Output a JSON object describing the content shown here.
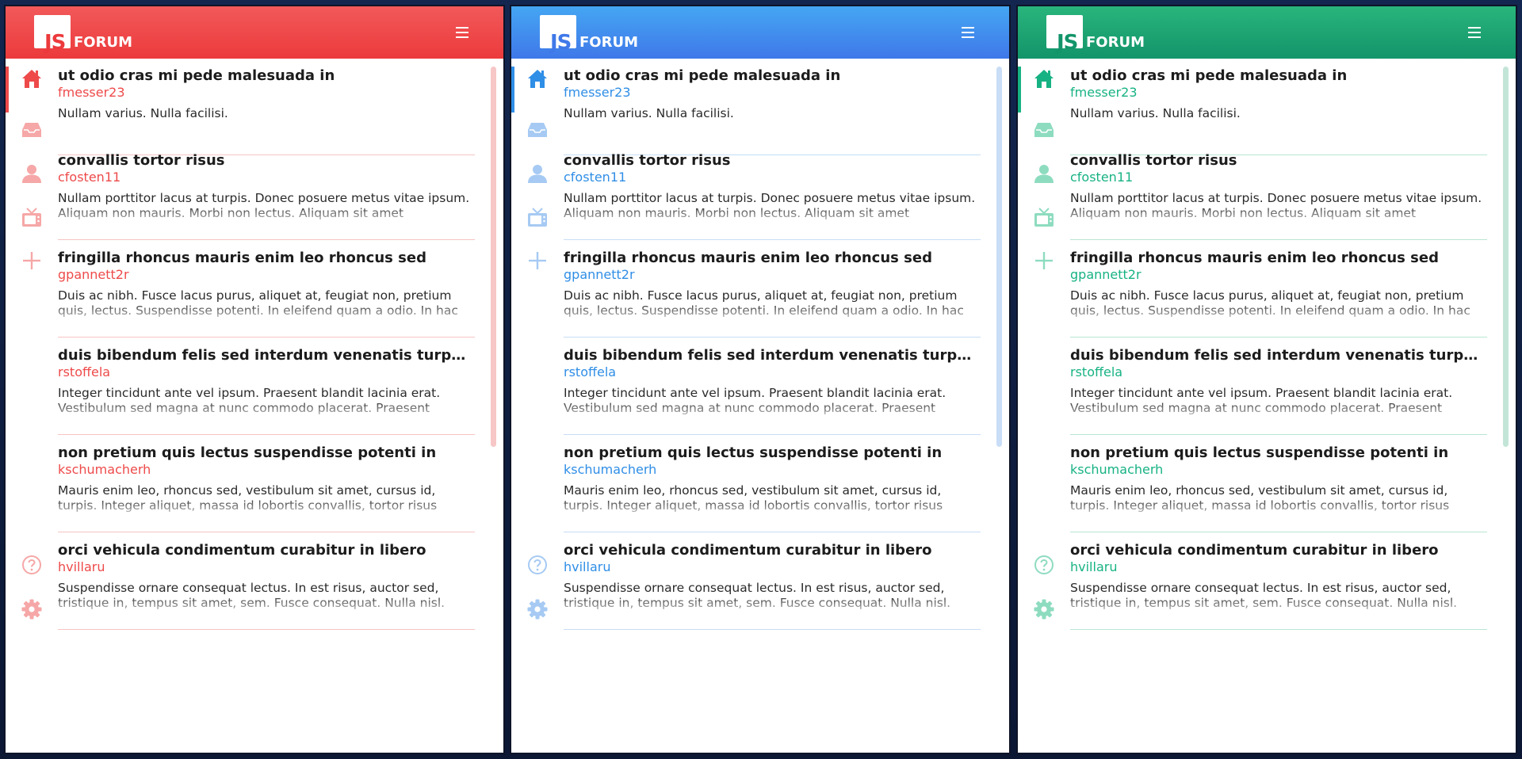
{
  "brand": {
    "logo_js": "JS",
    "logo_word": "FORUM"
  },
  "themes": [
    {
      "name": "red",
      "header_top": "#f2595a",
      "header_bottom": "#ec3a3c",
      "accent": "#ee4a4a",
      "icon_faded": "#f6a7a7",
      "divider": "#f7c3c3",
      "scroll": "#f7c6c6",
      "logo_text": "#ec3a3c"
    },
    {
      "name": "blue",
      "header_top": "#45a6f3",
      "header_bottom": "#3f78e9",
      "accent": "#2f8ee6",
      "icon_faded": "#a6caf3",
      "divider": "#c6ddf4",
      "scroll": "#c9def6",
      "logo_text": "#3f78e9"
    },
    {
      "name": "green",
      "header_top": "#29b57c",
      "header_bottom": "#13946a",
      "accent": "#17b283",
      "icon_faded": "#8edcc0",
      "divider": "#b7e6d2",
      "scroll": "#c3e5d7",
      "logo_text": "#13946a"
    }
  ],
  "nav": [
    {
      "icon": "home-icon",
      "active": true
    },
    {
      "icon": "inbox-icon",
      "active": false
    },
    {
      "icon": "user-icon",
      "active": false
    },
    {
      "icon": "tv-icon",
      "active": false
    },
    {
      "icon": "plus-icon",
      "active": false
    },
    {
      "icon": "help-icon",
      "active": false
    },
    {
      "icon": "gear-icon",
      "active": false
    }
  ],
  "posts": [
    {
      "title": "ut odio cras mi pede malesuada in",
      "author": "fmesser23",
      "body": "Nullam varius. Nulla facilisi."
    },
    {
      "title": "convallis tortor risus",
      "author": "cfosten11",
      "body": "Nullam porttitor lacus at turpis. Donec posuere metus vitae ipsum. Aliquam non mauris. Morbi non lectus. Aliquam sit amet"
    },
    {
      "title": "fringilla rhoncus mauris enim leo rhoncus sed",
      "author": "gpannett2r",
      "body": "Duis ac nibh. Fusce lacus purus, aliquet at, feugiat non, pretium quis, lectus. Suspendisse potenti. In eleifend quam a odio. In hac"
    },
    {
      "title": "duis bibendum felis sed interdum venenatis turpis enim blandit mi",
      "author": "rstoffela",
      "body": "Integer tincidunt ante vel ipsum. Praesent blandit lacinia erat. Vestibulum sed magna at nunc commodo placerat. Praesent"
    },
    {
      "title": "non pretium quis lectus suspendisse potenti in",
      "author": "kschumacherh",
      "body": "Mauris enim leo, rhoncus sed, vestibulum sit amet, cursus id, turpis. Integer aliquet, massa id lobortis convallis, tortor risus"
    },
    {
      "title": "orci vehicula condimentum curabitur in libero",
      "author": "hvillaru",
      "body": "Suspendisse ornare consequat lectus. In est risus, auctor sed, tristique in, tempus sit amet, sem. Fusce consequat. Nulla nisl."
    }
  ]
}
